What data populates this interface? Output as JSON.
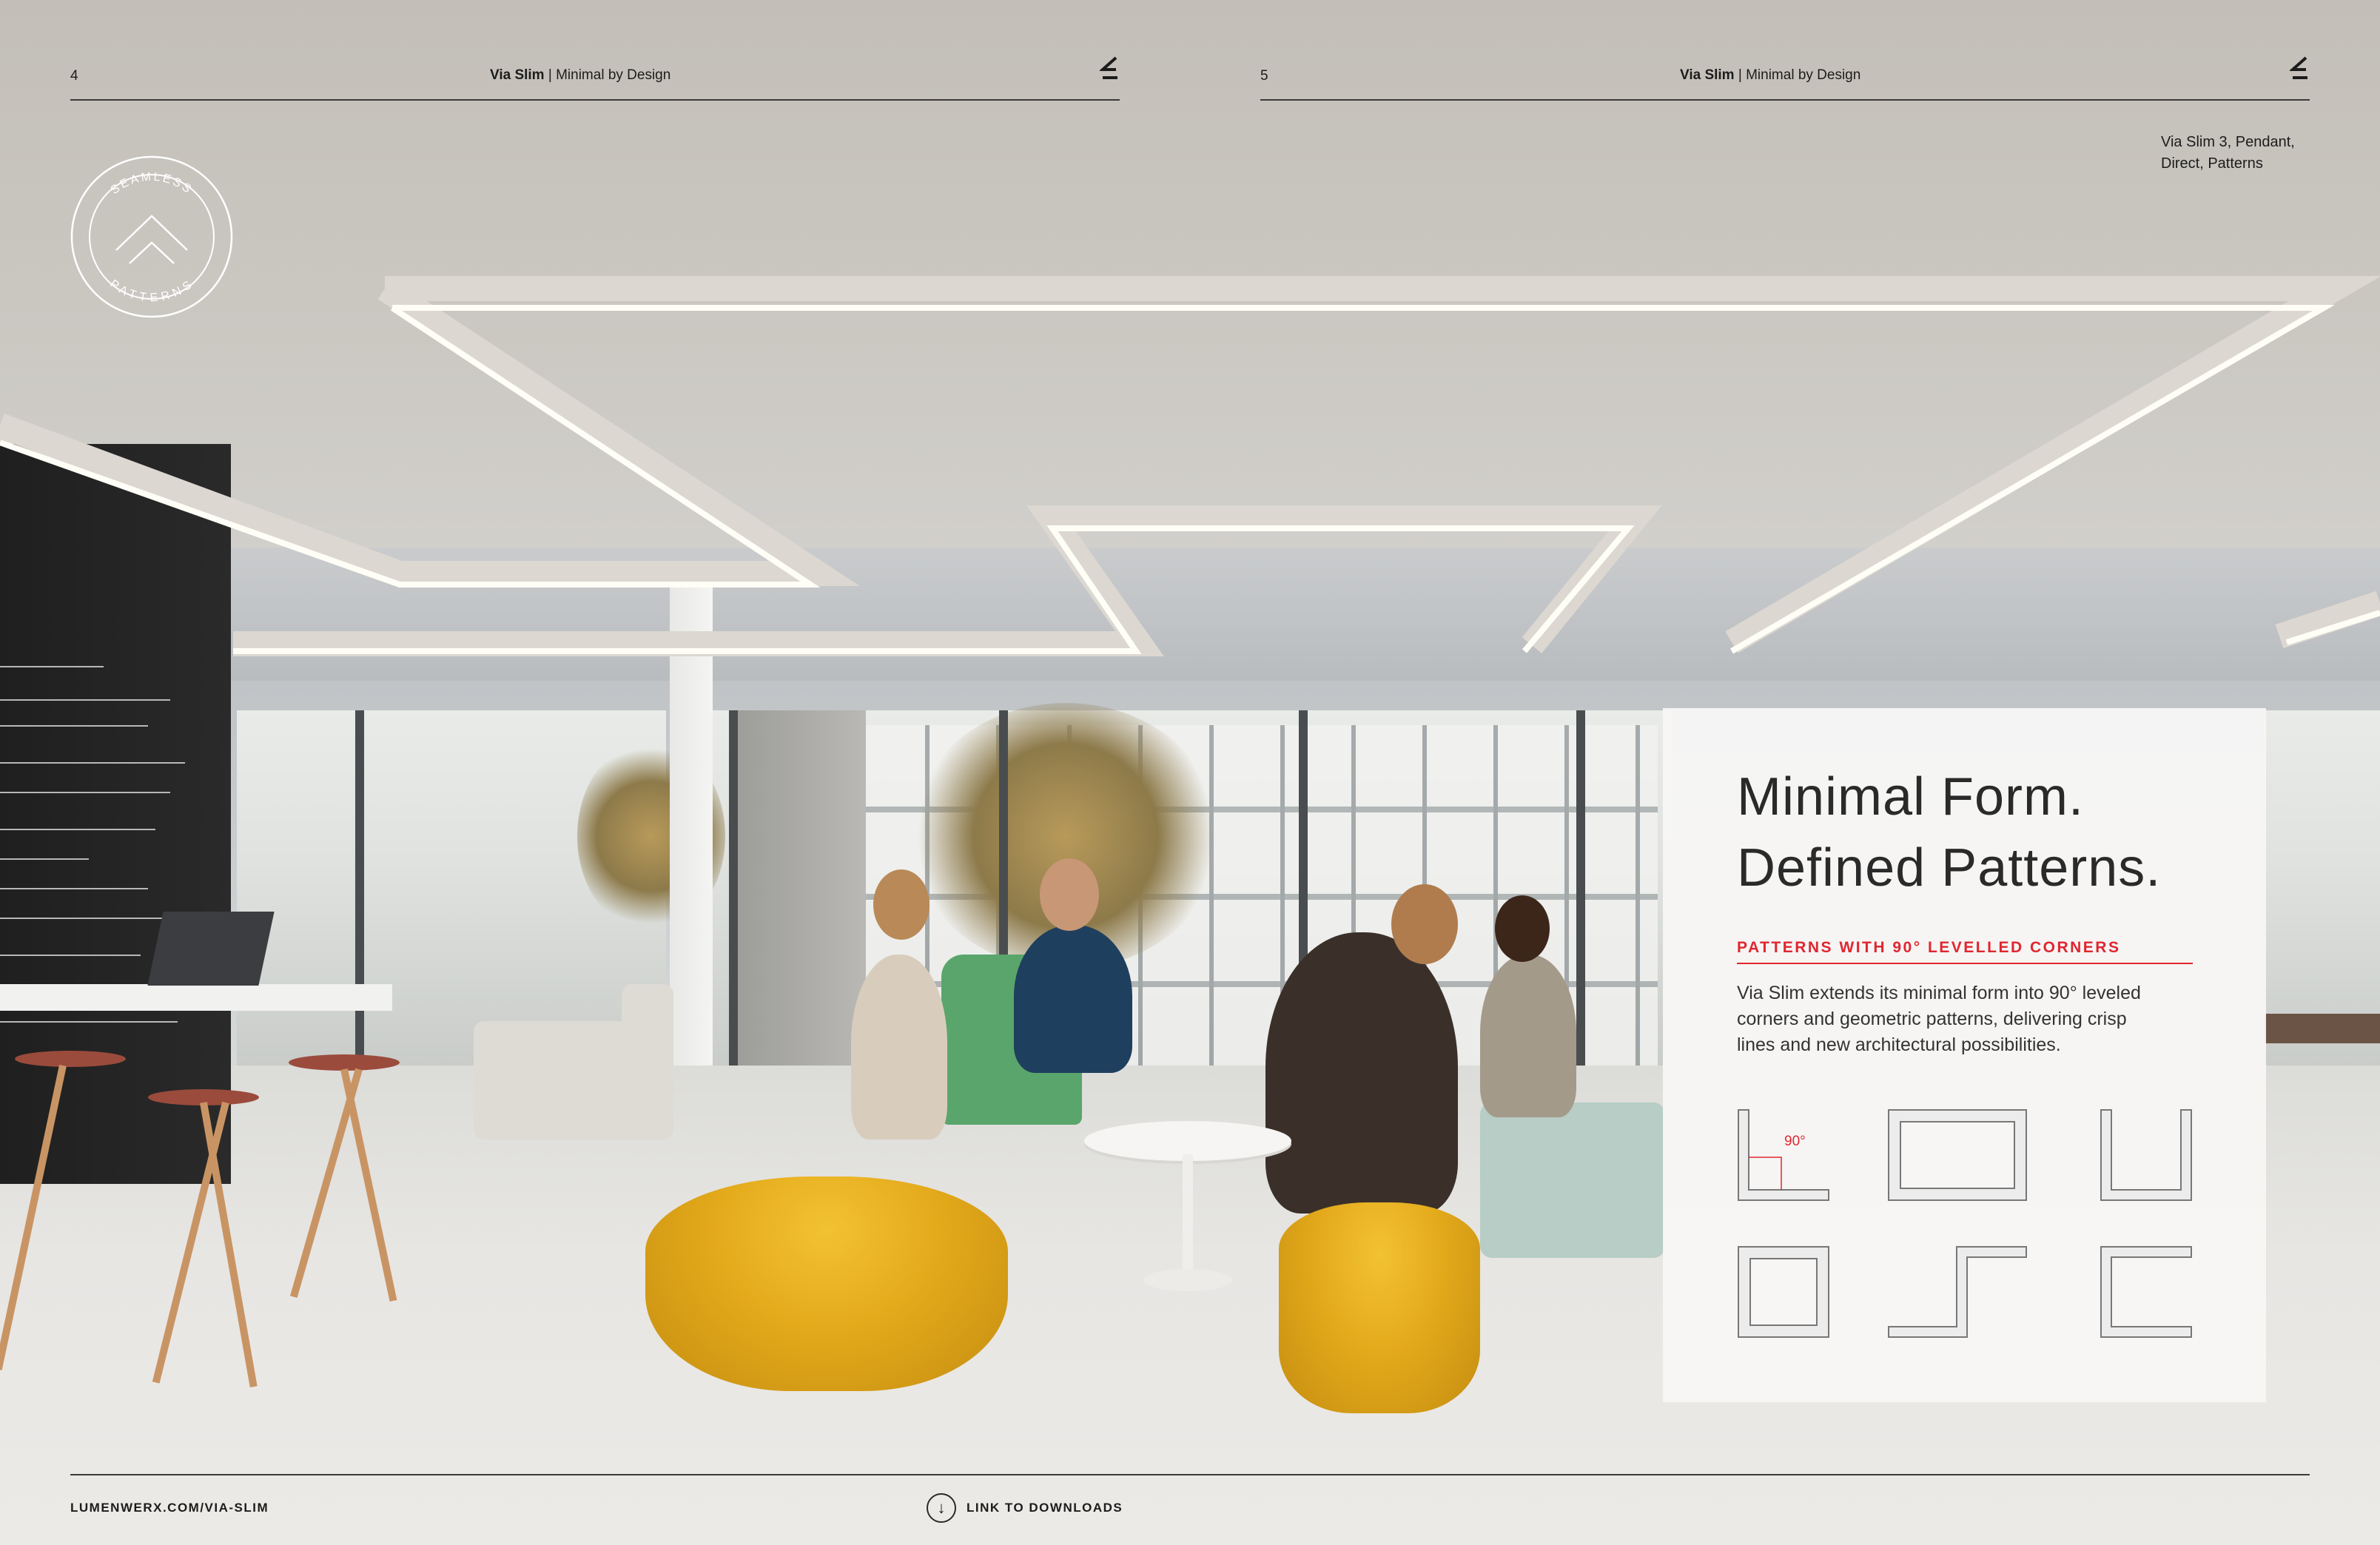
{
  "header": {
    "left_page_number": "4",
    "right_page_number": "5",
    "product": "Via Slim",
    "separator": " | ",
    "tagline": "Minimal by Design"
  },
  "badge": {
    "top_text": "SEAMLESS",
    "bottom_text": "PATTERNS"
  },
  "caption": {
    "line1": "Via Slim 3, Pendant,",
    "line2": "Direct, Patterns"
  },
  "card": {
    "title_line1": "Minimal Form.",
    "title_line2": "Defined Patterns.",
    "subtitle": "PATTERNS WITH 90° LEVELLED CORNERS",
    "body_line1": "Via Slim extends its minimal form into 90° leveled",
    "body_line2": "corners and geometric patterns, delivering crisp",
    "body_line3": "lines and new architectural possibilities.",
    "angle_label": "90°",
    "accent_color": "#e0262f"
  },
  "icons": {
    "brand_mark": "lumenwerx-logo-icon",
    "download": "arrow-down-circle-icon"
  },
  "footer": {
    "url": "LUMENWERX.COM/VIA-SLIM",
    "downloads_label": "LINK TO DOWNLOADS"
  }
}
